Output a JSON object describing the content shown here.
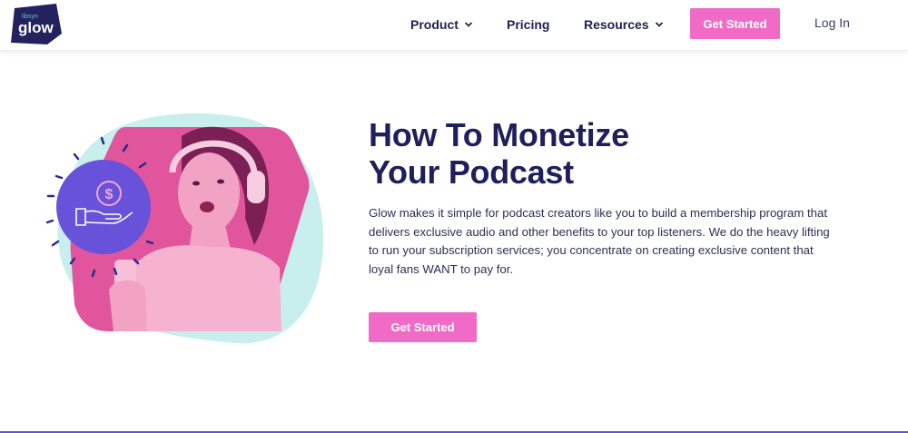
{
  "header": {
    "logo": {
      "small_text": "libsyn",
      "text": "glow",
      "icon": "glow-logo"
    },
    "nav": [
      {
        "label": "Product",
        "has_dropdown": true,
        "icon": "chevron-down-icon"
      },
      {
        "label": "Pricing",
        "has_dropdown": false
      },
      {
        "label": "Resources",
        "has_dropdown": true,
        "icon": "chevron-down-icon"
      }
    ],
    "cta_label": "Get Started",
    "login_label": "Log In"
  },
  "hero": {
    "title_line1": "How To Monetize",
    "title_line2": "Your Podcast",
    "description": "Glow makes it simple for podcast creators like you to build a membership program that delivers exclusive audio and other benefits to your top listeners. We do the heavy lifting to run your subscription services; you concentrate on creating exclusive content that loyal fans WANT to pay for.",
    "cta_label": "Get Started",
    "illustration": {
      "subject": "woman-with-headphones-holding-phone",
      "badge_icon": "dollar-hand-icon"
    }
  },
  "colors": {
    "brand_navy": "#1f1f5c",
    "accent_pink": "#f06bc6",
    "photo_pink": "#e0559c",
    "mint": "#c9eeee",
    "badge_purple": "#6752d9",
    "bottom_line": "#6c4fd8"
  }
}
